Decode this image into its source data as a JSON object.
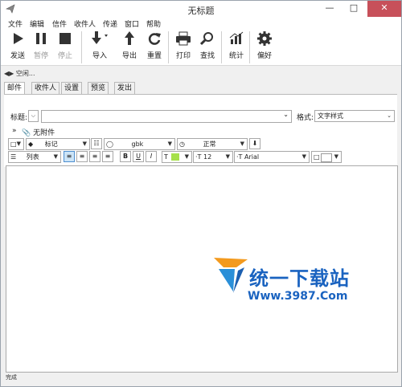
{
  "window": {
    "title": "无标题"
  },
  "menu": [
    "文件",
    "编辑",
    "信件",
    "收件人",
    "传递",
    "窗口",
    "帮助"
  ],
  "toolbar": {
    "send": "发送",
    "pause": "暂停",
    "stop": "停止",
    "import": "导入",
    "export": "导出",
    "reset": "重置",
    "print": "打印",
    "find": "查找",
    "stats": "统计",
    "prefs": "偏好"
  },
  "status_line": "空闲...",
  "tabs": [
    "邮件",
    "收件人",
    "设置",
    "预览",
    "发出"
  ],
  "form": {
    "subject_label": "标题:",
    "format_label": "格式:",
    "format_value": "文字样式",
    "attachment": "无附件"
  },
  "format_toolbar": {
    "tag": "标记",
    "encoding": "gbk",
    "priority": "正常",
    "list": "列表",
    "font_size": "12",
    "font_name": "Arial",
    "bold": "B",
    "underline": "U",
    "italic": "I",
    "text_color_icon": "T",
    "highlight_color": "#a6e04a"
  },
  "watermark": {
    "cn": "统一下载站",
    "url": "Www.3987.Com"
  },
  "statusbar": "完成"
}
